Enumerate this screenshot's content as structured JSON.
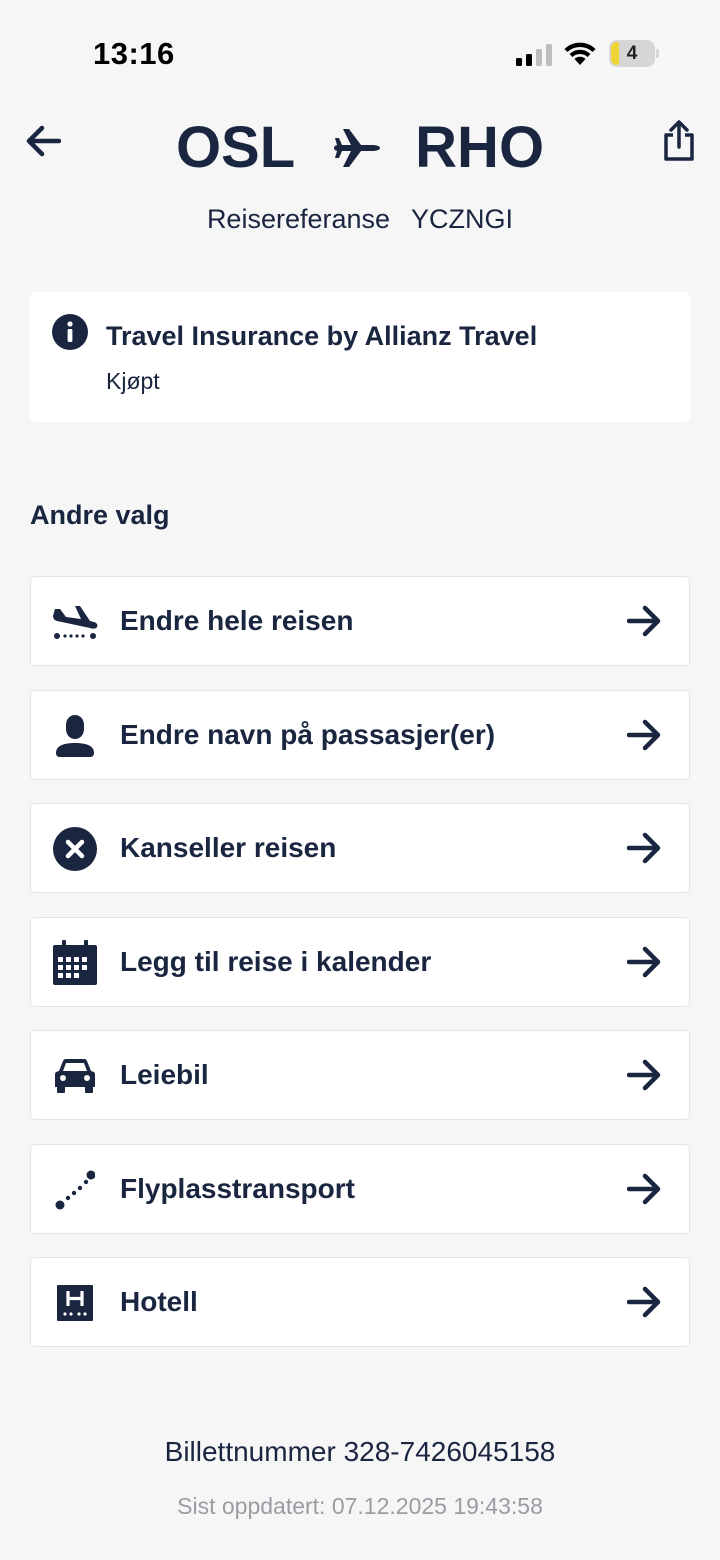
{
  "status_bar": {
    "time": "13:16",
    "battery_level": "4",
    "icons": [
      "cellular-signal-icon",
      "wifi-icon",
      "battery-icon"
    ]
  },
  "header": {
    "origin": "OSL",
    "destination": "RHO",
    "route_icon": "plane-icon",
    "back_icon": "arrow-left-icon",
    "share_icon": "share-icon",
    "reference_label": "Reisereferanse",
    "reference_code": "YCZNGI"
  },
  "info_card": {
    "icon": "info-icon",
    "title": "Travel Insurance by Allianz Travel",
    "status": "Kjøpt"
  },
  "other_options": {
    "title": "Andre valg",
    "items": [
      {
        "label": "Endre hele reisen",
        "icon": "plane-landing-icon"
      },
      {
        "label": "Endre navn på passasjer(er)",
        "icon": "person-icon"
      },
      {
        "label": "Kanseller reisen",
        "icon": "cancel-circle-icon"
      },
      {
        "label": "Legg til reise i kalender",
        "icon": "calendar-icon"
      },
      {
        "label": "Leiebil",
        "icon": "car-icon"
      },
      {
        "label": "Flyplasstransport",
        "icon": "route-dots-icon"
      },
      {
        "label": "Hotell",
        "icon": "hotel-icon"
      }
    ]
  },
  "footer": {
    "ticket_number": "Billettnummer 328-7426045158",
    "last_updated": "Sist oppdatert: 07.12.2025 19:43:58"
  },
  "colors": {
    "primary_text": "#1a2540",
    "background": "#f6f6f7",
    "card": "#ffffff",
    "muted_text": "#9a9ca3",
    "battery_accent": "#f0d335"
  }
}
